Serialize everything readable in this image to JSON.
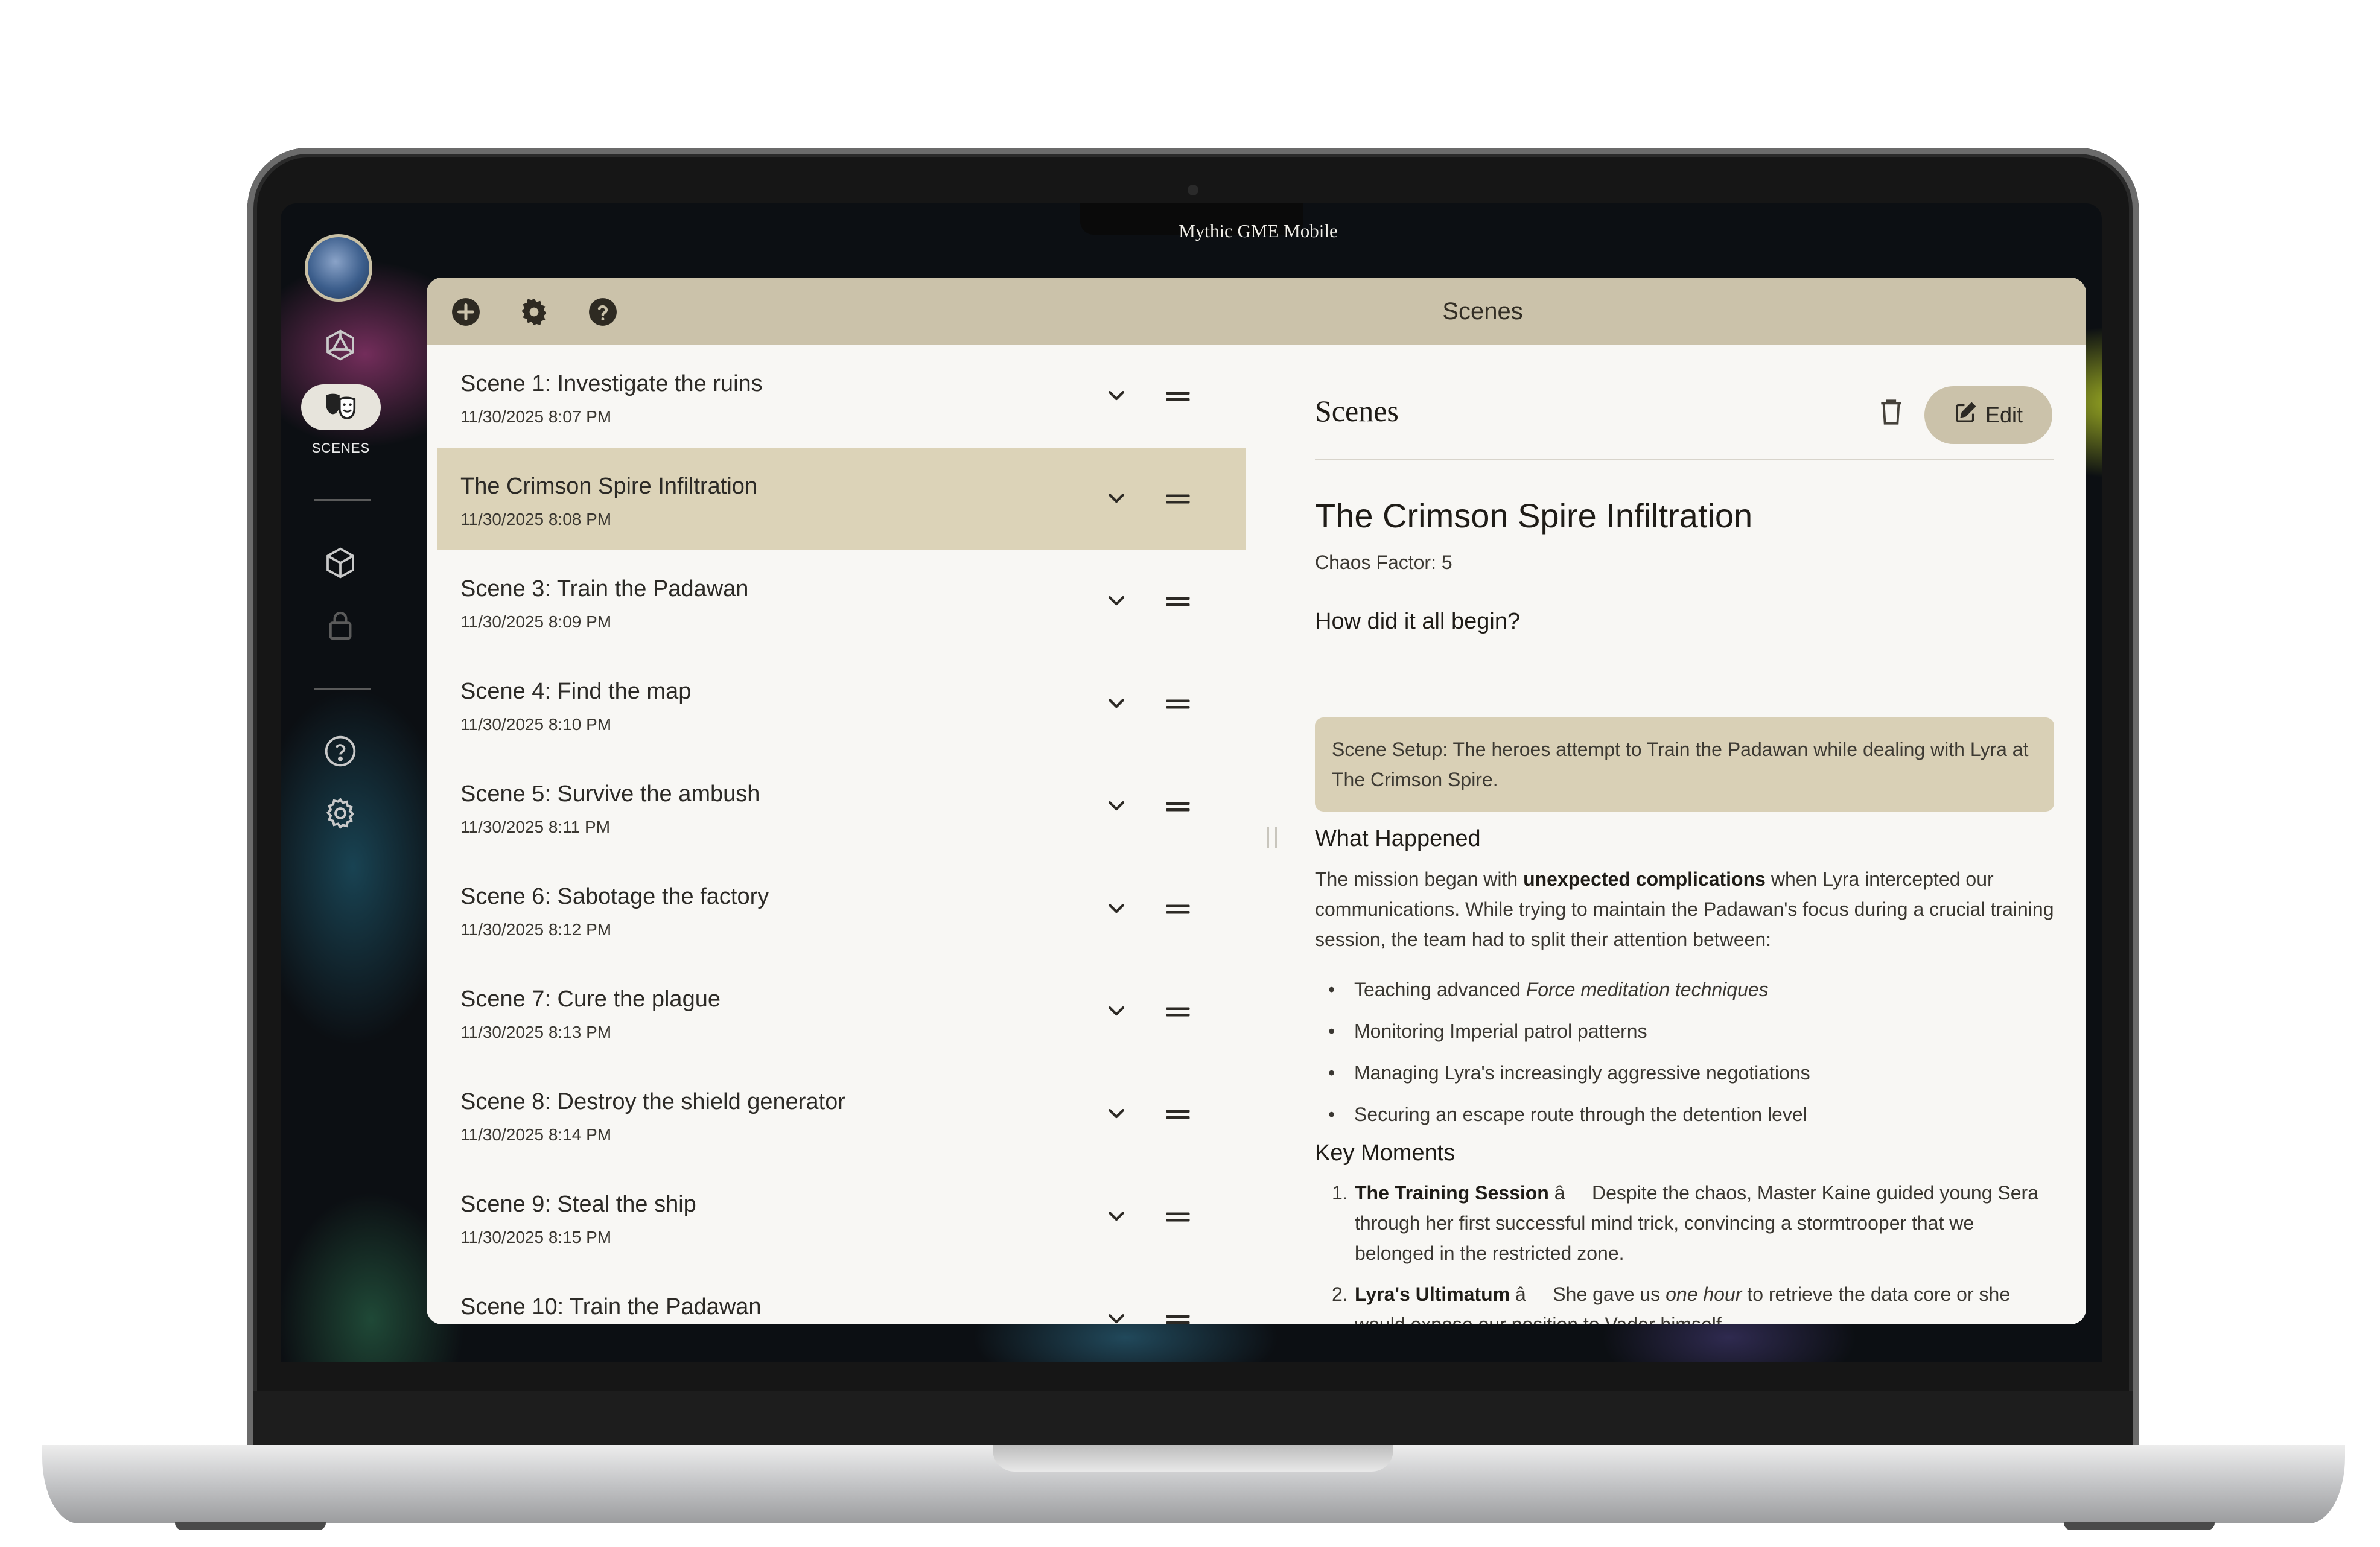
{
  "window": {
    "title": "Mythic GME Mobile"
  },
  "nav_rail": {
    "active_label": "SCENES",
    "icons": [
      "avatar",
      "dice-icon",
      "theater-masks-icon",
      "cube-icon",
      "lock-icon",
      "help-icon",
      "settings-icon"
    ]
  },
  "toolbar": {
    "title": "Scenes"
  },
  "scenes": [
    {
      "title": "Scene 1: Investigate the ruins",
      "date": "11/30/2025 8:07 PM"
    },
    {
      "title": "The Crimson Spire Infiltration",
      "date": "11/30/2025 8:08 PM",
      "selected": true
    },
    {
      "title": "Scene 3: Train the Padawan",
      "date": "11/30/2025 8:09 PM"
    },
    {
      "title": "Scene 4: Find the map",
      "date": "11/30/2025 8:10 PM"
    },
    {
      "title": "Scene 5: Survive the ambush",
      "date": "11/30/2025 8:11 PM"
    },
    {
      "title": "Scene 6: Sabotage the factory",
      "date": "11/30/2025 8:12 PM"
    },
    {
      "title": "Scene 7: Cure the plague",
      "date": "11/30/2025 8:13 PM"
    },
    {
      "title": "Scene 8: Destroy the shield generator",
      "date": "11/30/2025 8:14 PM"
    },
    {
      "title": "Scene 9: Steal the ship",
      "date": "11/30/2025 8:15 PM"
    },
    {
      "title": "Scene 10: Train the Padawan",
      "date": ""
    }
  ],
  "detail": {
    "heading": "Scenes",
    "edit_label": "Edit",
    "scene_name": "The Crimson Spire Infiltration",
    "chaos_factor": "Chaos Factor: 5",
    "begin_heading": "How did it all begin?",
    "setup_text": "Scene Setup: The heroes attempt to Train the Padawan while dealing with Lyra at The Crimson Spire.",
    "what_heading": "What Happened",
    "what_text_1": "The mission began with ",
    "what_text_bold": "unexpected complications",
    "what_text_2": " when Lyra intercepted our communications. While trying to maintain the Padawan's focus during a crucial training session, the team had to split their attention between:",
    "bullets": {
      "b1_pre": "Teaching advanced ",
      "b1_em": "Force meditation techniques",
      "b2": "Monitoring Imperial patrol patterns",
      "b3": "Managing Lyra's increasingly aggressive negotiations",
      "b4": "Securing an escape route through the detention level"
    },
    "moments_heading": "Key Moments",
    "moments": {
      "m1_num": "1.",
      "m1_bold": "The Training Session",
      "m1_sep": " â     ",
      "m1_text": "Despite the chaos, Master Kaine guided young Sera through her first successful mind trick, convincing a stormtrooper that we belonged in the restricted zone.",
      "m2_num": "2.",
      "m2_bold": "Lyra's Ultimatum",
      "m2_sep": " â     ",
      "m2_text_1": "She gave us ",
      "m2_em": "one hour",
      "m2_text_2": " to retrieve the data core or she would expose our position to Vader himself."
    }
  }
}
